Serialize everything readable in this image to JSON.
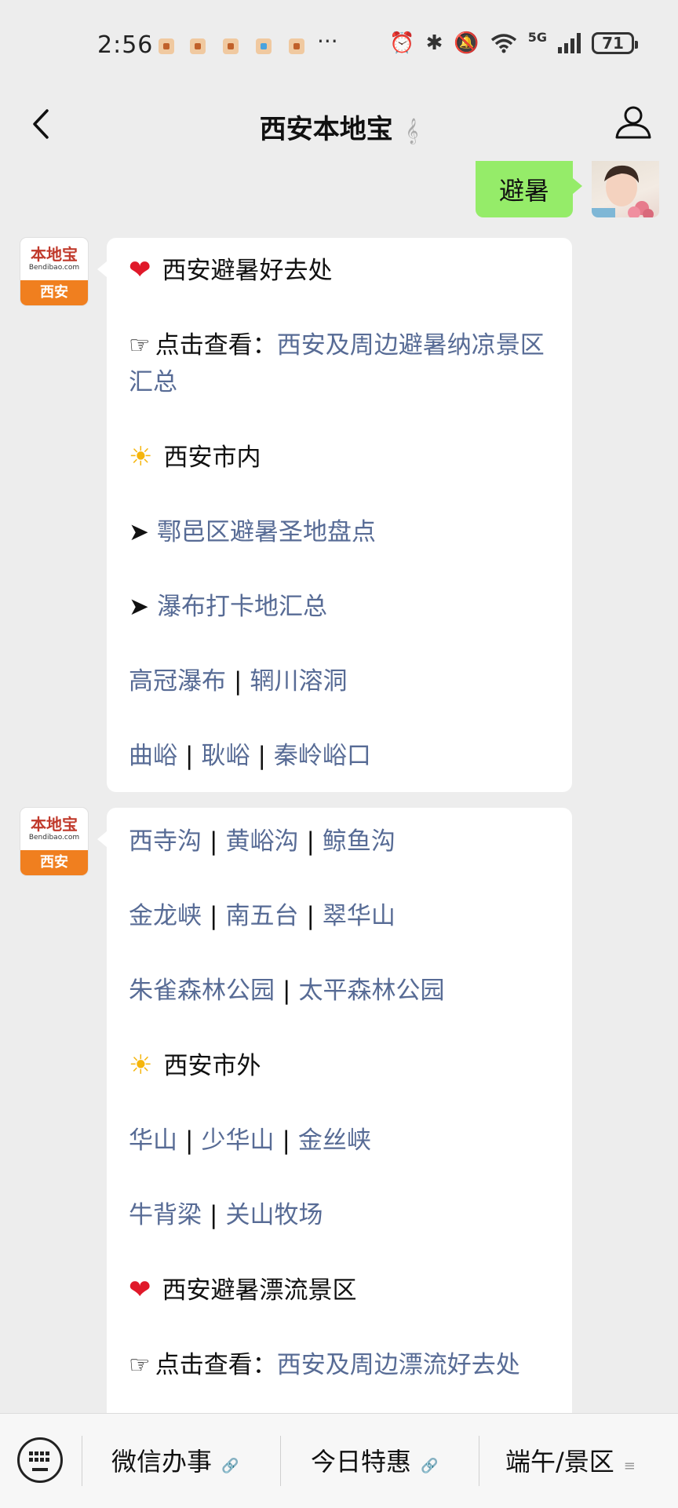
{
  "status_bar": {
    "time": "2:56",
    "more": "···",
    "network": "5G",
    "battery": "71"
  },
  "header": {
    "title": "西安本地宝"
  },
  "chat": {
    "my_message": "避暑",
    "bot_avatar": {
      "brand": "本地宝",
      "domain": "Bendibao.com",
      "city": "西安"
    },
    "bubble1": {
      "heading": "西安避暑好去处",
      "see_prefix": "点击查看：",
      "see_link": "西安及周边避暑纳凉景区汇总",
      "section_city": "西安市内",
      "link_huyi": "鄠邑区避暑圣地盘点",
      "link_waterfall": "瀑布打卡地汇总",
      "row1": [
        "高冠瀑布",
        "辋川溶洞"
      ],
      "row2": [
        "曲峪",
        "耿峪",
        "秦岭峪口"
      ]
    },
    "bubble2": {
      "row1": [
        "西寺沟",
        "黄峪沟",
        "鲸鱼沟"
      ],
      "row2": [
        "金龙峡",
        "南五台",
        "翠华山"
      ],
      "row3": [
        "朱雀森林公园",
        "太平森林公园"
      ],
      "section_outside": "西安市外",
      "row4": [
        "华山",
        "少华山",
        "金丝峡"
      ],
      "row5": [
        "牛背梁",
        "关山牧场"
      ],
      "heading_rafting": "西安避暑漂流景区",
      "see_prefix": "点击查看：",
      "see_link": "西安及周边漂流好去处"
    }
  },
  "bottom_menu": {
    "items": [
      "微信办事",
      "今日特惠",
      "端午/景区"
    ]
  }
}
